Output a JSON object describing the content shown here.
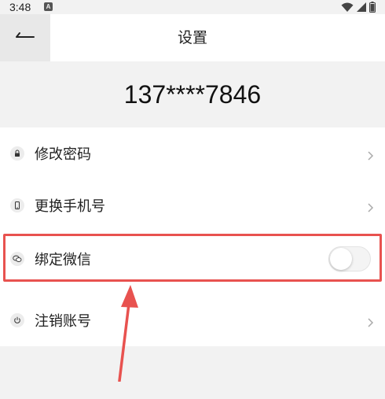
{
  "status_bar": {
    "time": "3:48",
    "notification_glyph": "A",
    "icons": [
      "wifi-icon",
      "signal-icon",
      "battery-icon"
    ]
  },
  "header": {
    "title": "设置",
    "back_icon": "back-arrow-icon"
  },
  "account": {
    "phone": "137****7846"
  },
  "settings": {
    "items": [
      {
        "label": "修改密码",
        "icon": "lock-icon",
        "control": "chevron"
      },
      {
        "label": "更换手机号",
        "icon": "phone-icon",
        "control": "chevron"
      },
      {
        "label": "绑定微信",
        "icon": "wechat-icon",
        "control": "toggle",
        "toggle_on": false
      },
      {
        "label": "注销账号",
        "icon": "power-icon",
        "control": "chevron"
      }
    ]
  },
  "annotation": {
    "highlight_color": "#e8524f"
  }
}
